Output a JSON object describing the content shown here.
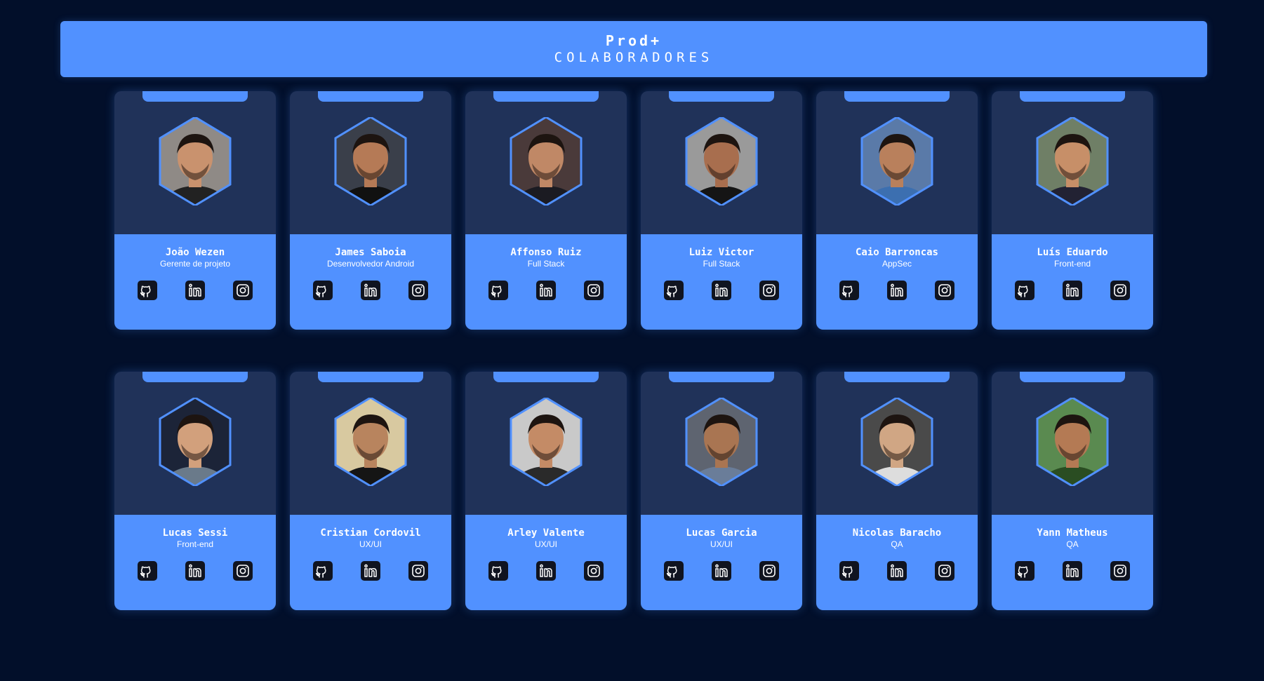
{
  "header": {
    "brand": "Prod+",
    "subtitle": "COLABORADORES"
  },
  "icons": {
    "github": "github-icon",
    "linkedin": "linkedin-icon",
    "instagram": "instagram-icon"
  },
  "colors": {
    "background": "#020f2a",
    "accent": "#5191ff",
    "card": "#203259",
    "icon_tile": "#101420"
  },
  "members": [
    {
      "name": "João Wezen",
      "role": "Gerente de projeto"
    },
    {
      "name": "James Saboia",
      "role": "Desenvolvedor Android"
    },
    {
      "name": "Affonso Ruiz",
      "role": "Full Stack"
    },
    {
      "name": "Luiz Victor",
      "role": "Full Stack"
    },
    {
      "name": "Caio Barroncas",
      "role": "AppSec"
    },
    {
      "name": "Luís Eduardo",
      "role": "Front-end"
    },
    {
      "name": "Lucas Sessi",
      "role": "Front-end"
    },
    {
      "name": "Cristian Cordovil",
      "role": "UX/UI"
    },
    {
      "name": "Arley Valente",
      "role": "UX/UI"
    },
    {
      "name": "Lucas Garcia",
      "role": "UX/UI"
    },
    {
      "name": "Nicolas Baracho",
      "role": "QA"
    },
    {
      "name": "Yann Matheus",
      "role": "QA"
    }
  ]
}
